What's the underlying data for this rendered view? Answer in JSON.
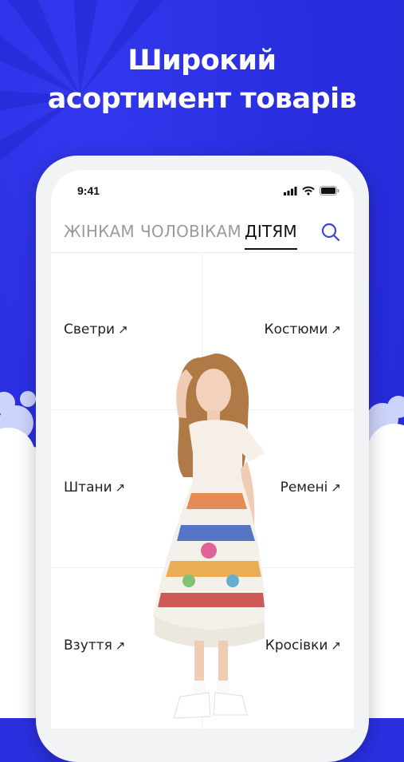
{
  "headline": {
    "line1": "Широкий",
    "line2": "асортимент товарів"
  },
  "status_bar": {
    "time": "9:41"
  },
  "tabs": [
    {
      "label": "ЖІНКАМ",
      "active": false
    },
    {
      "label": "ЧОЛОВІКАМ",
      "active": false
    },
    {
      "label": "ДІТЯМ",
      "active": true
    }
  ],
  "categories": [
    {
      "label": "Светри"
    },
    {
      "label": "Костюми"
    },
    {
      "label": "Штани"
    },
    {
      "label": "Ремені"
    },
    {
      "label": "Взуття"
    },
    {
      "label": "Кросівки"
    }
  ],
  "icons": {
    "search": "search-icon",
    "arrow": "arrow-up-right-icon"
  },
  "colors": {
    "background": "#2b2fe0",
    "search_icon": "#3a44e6",
    "active_tab": "#111111",
    "inactive_tab": "#9a9a9a"
  }
}
